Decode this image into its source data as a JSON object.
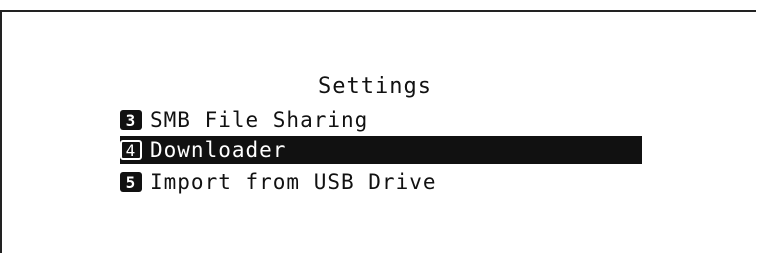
{
  "screen": {
    "title": "Settings",
    "items": [
      {
        "number": "3",
        "label": "SMB File Sharing",
        "selected": false
      },
      {
        "number": "4",
        "label": "Downloader",
        "selected": true
      },
      {
        "number": "5",
        "label": "Import from USB Drive",
        "selected": false
      }
    ]
  },
  "colors": {
    "background": "#ffffff",
    "text": "#111111",
    "highlight": "#111111",
    "highlight_text": "#ffffff"
  }
}
